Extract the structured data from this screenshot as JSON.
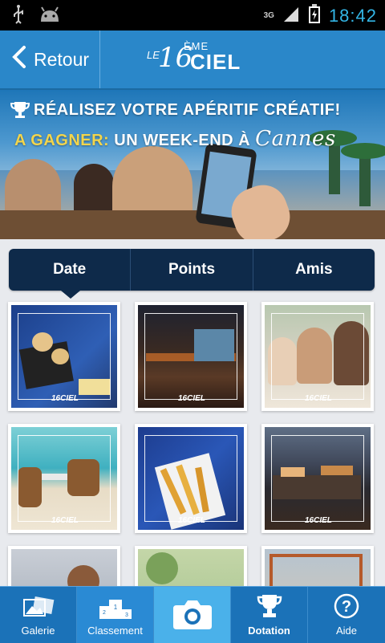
{
  "statusbar": {
    "network": "3G",
    "time": "18:42"
  },
  "appbar": {
    "back_label": "Retour",
    "logo": {
      "le": "LE",
      "number": "16",
      "eme": "ÈME",
      "ciel": "CIEL"
    }
  },
  "banner": {
    "line1": "RÉALISEZ VOTRE APÉRITIF CRÉATIF!",
    "line2_prefix": "A GAGNER:",
    "line2_main": "UN WEEK-END À",
    "line2_city": "Cannes"
  },
  "tabs": [
    {
      "label": "Date"
    },
    {
      "label": "Points"
    },
    {
      "label": "Amis"
    }
  ],
  "gallery": {
    "watermark": "16CIEL"
  },
  "navbar": {
    "galerie": "Galerie",
    "classement": "Classement",
    "dotation": "Dotation",
    "aide": "Aide"
  },
  "colors": {
    "appbar": "#2a87c9",
    "tabs": "#0e2a4a",
    "navbar": "#1b72b8",
    "camera": "#4ab1ea",
    "status": "#33b5e5"
  }
}
